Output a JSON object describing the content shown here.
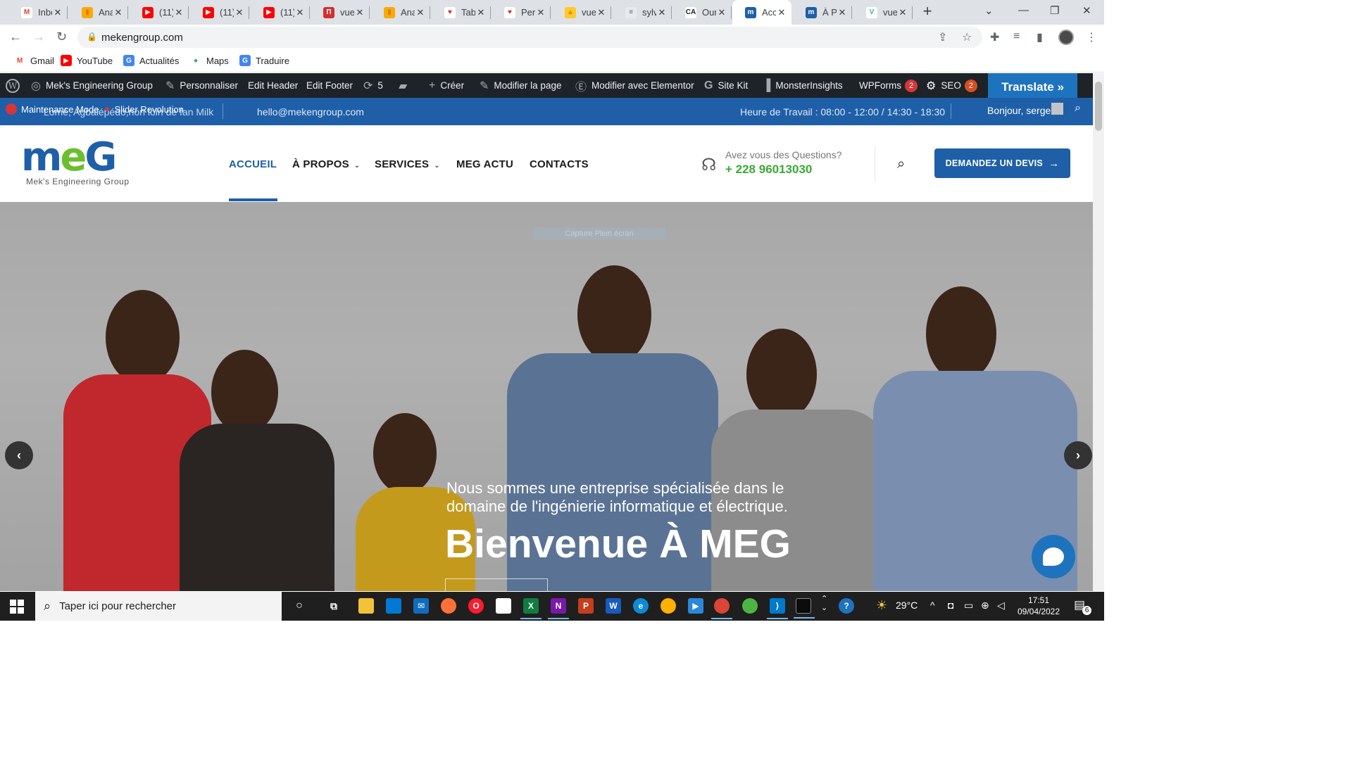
{
  "browser": {
    "tabs": [
      {
        "title": "Inbo",
        "icon": "gmail-icon",
        "color": "#ffffff",
        "glyph": "M",
        "fg": "#ea4335"
      },
      {
        "title": "Ana",
        "icon": "analytics-icon",
        "color": "#f9ab00",
        "glyph": "▮",
        "fg": "#e37400"
      },
      {
        "title": "(11)",
        "icon": "youtube-icon",
        "color": "#ff0000",
        "glyph": "▶",
        "fg": "#ffffff"
      },
      {
        "title": "(11)",
        "icon": "youtube-icon",
        "color": "#ff0000",
        "glyph": "▶",
        "fg": "#ffffff"
      },
      {
        "title": "(11)",
        "icon": "youtube-icon",
        "color": "#ff0000",
        "glyph": "▶",
        "fg": "#ffffff"
      },
      {
        "title": "vue",
        "icon": "vue-docs-icon",
        "color": "#d32f2f",
        "glyph": "П",
        "fg": "#ffffff"
      },
      {
        "title": "Ana",
        "icon": "analytics-icon",
        "color": "#f9ab00",
        "glyph": "▮",
        "fg": "#e37400"
      },
      {
        "title": "Tabl",
        "icon": "heart-app-icon",
        "color": "#ffffff",
        "glyph": "♥",
        "fg": "#d93025"
      },
      {
        "title": "Pers",
        "icon": "heart-app-icon",
        "color": "#ffffff",
        "glyph": "♥",
        "fg": "#d93025"
      },
      {
        "title": "vue",
        "icon": "firebase-icon",
        "color": "#ffca28",
        "glyph": "▲",
        "fg": "#f57c00"
      },
      {
        "title": "sylv",
        "icon": "document-icon",
        "color": "#e8eaed",
        "glyph": "≡",
        "fg": "#5f6368"
      },
      {
        "title": "Our",
        "icon": "ca-icon",
        "color": "#ffffff",
        "glyph": "CA",
        "fg": "#202124"
      },
      {
        "title": "Acc",
        "icon": "meg-site-icon",
        "color": "#1e5fa8",
        "glyph": "m",
        "fg": "#ffffff"
      },
      {
        "title": "À P",
        "icon": "meg-site-icon",
        "color": "#1e5fa8",
        "glyph": "m",
        "fg": "#ffffff"
      },
      {
        "title": "vue",
        "icon": "vue-icon",
        "color": "#ffffff",
        "glyph": "V",
        "fg": "#41b883"
      }
    ],
    "url": "mekengroup.com",
    "bookmarks": [
      {
        "label": "Gmail",
        "icon": "gmail-icon",
        "color": "#ffffff",
        "glyph": "M",
        "fg": "#ea4335"
      },
      {
        "label": "YouTube",
        "icon": "youtube-icon",
        "color": "#ff0000",
        "glyph": "▶",
        "fg": "#ffffff"
      },
      {
        "label": "Actualités",
        "icon": "google-news-icon",
        "color": "#4285f4",
        "glyph": "G",
        "fg": "#ffffff"
      },
      {
        "label": "Maps",
        "icon": "maps-icon",
        "color": "#ffffff",
        "glyph": "●",
        "fg": "#34a853"
      },
      {
        "label": "Traduire",
        "icon": "translate-icon",
        "color": "#4285f4",
        "glyph": "G",
        "fg": "#ffffff"
      }
    ]
  },
  "wpbar": {
    "site_name": "Mek's Engineering Group",
    "personalize": "Personnaliser",
    "edit_header": "Edit Header",
    "edit_footer": "Edit Footer",
    "updates_count": "5",
    "create": "Créer",
    "edit_page": "Modifier la page",
    "edit_elementor": "Modifier avec Elementor",
    "site_kit": "Site Kit",
    "monsterinsights": "MonsterInsights",
    "wpforms": "WPForms",
    "wpforms_badge": "2",
    "seo": "SEO",
    "seo_badge": "2",
    "translate": "Translate »"
  },
  "topbar": {
    "address": "Lomé, Agbalépédo,non loin de fan Milk",
    "maintenance": "Maintenance Mode",
    "slider": "Slider Revolution",
    "email": "hello@mekengroup.com",
    "hours": "Heure de Travail : 08:00 - 12:00 / 14:30 - 18:30",
    "greeting": "Bonjour, serge"
  },
  "header": {
    "logo_main": "m",
    "logo_e": "e",
    "logo_g": "G",
    "logo_sub": "Mek's Engineering Group",
    "nav": [
      "ACCUEIL",
      "À PROPOS",
      "SERVICES",
      "MEG ACTU",
      "CONTACTS"
    ],
    "question_label": "Avez vous des Questions?",
    "phone": "+ 228 96013030",
    "cta": "DEMANDEZ UN DEVIS"
  },
  "hero": {
    "capture_label": "Capture Plein écran",
    "subtitle": "Nous sommes une entreprise spécialisée dans le domaine de l'ingénierie informatique et électrique.",
    "title": "Bienvenue À MEG"
  },
  "taskbar": {
    "search_placeholder": "Taper ici pour rechercher",
    "temperature": "29°C",
    "time": "17:51",
    "date": "09/04/2022",
    "notifications": "6"
  },
  "colors": {
    "brand_blue": "#1e5fa8",
    "brand_green": "#3aaa35",
    "wp_dark": "#1d2327"
  }
}
